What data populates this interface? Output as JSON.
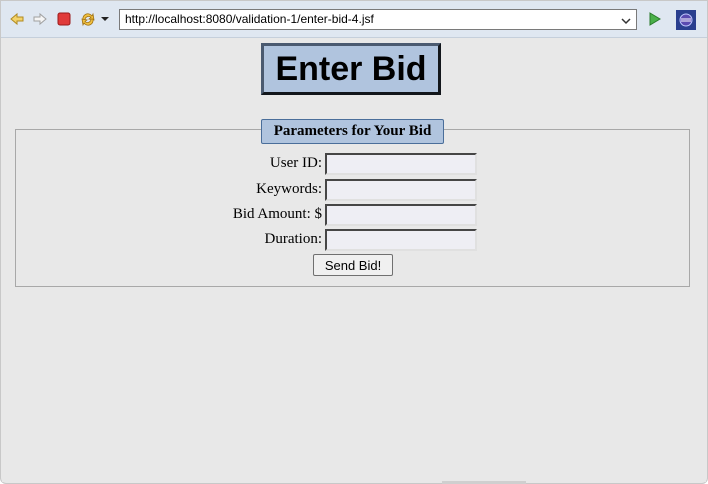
{
  "browser": {
    "url": "http://localhost:8080/validation-1/enter-bid-4.jsf",
    "icons": [
      "back-icon",
      "forward-icon",
      "stop-icon",
      "refresh-icon",
      "dropdown-icon",
      "go-icon",
      "eclipse-browser-icon"
    ],
    "colors": {
      "toolbar": "#dfe7f1",
      "go": "#3a9a3a",
      "stop": "#d83030"
    }
  },
  "page": {
    "title": "Enter Bid",
    "legend": "Parameters for Your Bid",
    "fields": [
      {
        "label": "User ID:",
        "value": ""
      },
      {
        "label": "Keywords:",
        "value": ""
      },
      {
        "label": "Bid Amount: $",
        "value": ""
      },
      {
        "label": "Duration:",
        "value": ""
      }
    ],
    "submit_label": "Send Bid!",
    "colors": {
      "accent": "#b0c4de",
      "background": "#e8e8e8"
    }
  }
}
